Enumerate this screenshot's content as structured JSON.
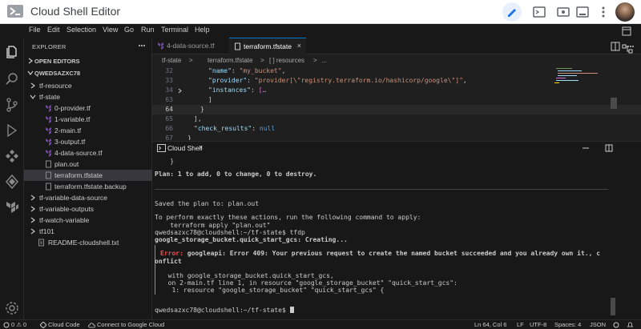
{
  "window": {
    "title": "Cloud Shell Editor"
  },
  "menu": [
    "File",
    "Edit",
    "Selection",
    "View",
    "Go",
    "Run",
    "Terminal",
    "Help"
  ],
  "explorer": {
    "header": "EXPLORER",
    "open_editors": "OPEN EDITORS",
    "workspace": "QWEDSAZXC78",
    "items": [
      {
        "label": "tf-resource",
        "type": "folder",
        "expanded": false
      },
      {
        "label": "tf-state",
        "type": "folder",
        "expanded": true
      },
      {
        "label": "0-provider.tf",
        "type": "tf"
      },
      {
        "label": "1-variable.tf",
        "type": "tf"
      },
      {
        "label": "2-main.tf",
        "type": "tf"
      },
      {
        "label": "3-output.tf",
        "type": "tf"
      },
      {
        "label": "4-data-source.tf",
        "type": "tf"
      },
      {
        "label": "plan.out",
        "type": "file"
      },
      {
        "label": "terraform.tfstate",
        "type": "file",
        "selected": true
      },
      {
        "label": "terraform.tfstate.backup",
        "type": "file"
      },
      {
        "label": "tf-variable-data-source",
        "type": "folder",
        "expanded": false
      },
      {
        "label": "tf-variable-outputs",
        "type": "folder",
        "expanded": false
      },
      {
        "label": "tf-watch-variable",
        "type": "folder",
        "expanded": false
      },
      {
        "label": "tf101",
        "type": "folder",
        "expanded": false
      },
      {
        "label": "README-cloudshell.txt",
        "type": "file"
      }
    ]
  },
  "tabs": [
    {
      "label": "4-data-source.tf",
      "active": false
    },
    {
      "label": "terraform.tfstate",
      "active": true,
      "close": "×"
    }
  ],
  "breadcrumb": [
    "tf-state",
    ">",
    "terraform.tfstate",
    ">",
    "[ ] resources",
    ">",
    "..."
  ],
  "code": {
    "line_numbers": [
      "32",
      "33",
      "34",
      "63",
      "64",
      "65",
      "66",
      "67"
    ],
    "lines": [
      {
        "key": "\"name\"",
        "sep": ": ",
        "val": "\"my_bucket\"",
        "end": ","
      },
      {
        "key": "\"provider\"",
        "sep": ": ",
        "val": "\"provider[\\\"registry.terraform.io/hashicorp/google\\\"]\"",
        "end": ","
      },
      {
        "key": "\"instances\"",
        "sep": ": ",
        "val": "[…",
        "end": ""
      },
      {
        "text": "]"
      },
      {
        "text": "}"
      },
      {
        "text": "],"
      },
      {
        "key": "\"check_results\"",
        "sep": ": ",
        "val": "null",
        "end": ""
      },
      {
        "text": "}"
      }
    ]
  },
  "terminal": {
    "tab_label": "Cloud Shell",
    "close": "×",
    "lines": [
      "    }",
      "Plan: 1 to add, 0 to change, 0 to destroy.",
      "Saved the plan to: plan.out",
      "To perform exactly these actions, run the following command to apply:",
      "    terraform apply \"plan.out\"",
      "qwedsazxc78@cloudshell:~/tf-state$ tfdp",
      "google_storage_bucket.quick_start_gcs: Creating...",
      "Error:",
      " googleapi: Error 409: Your previous request to create the named bucket succeeded and you already own it., c",
      "onflict",
      "  with google_storage_bucket.quick_start_gcs,",
      "  on 2-main.tf line 1, in resource \"google_storage_bucket\" \"quick_start_gcs\":",
      "   1: resource \"google_storage_bucket\" \"quick_start_gcs\" {",
      "qwedsazxc78@cloudshell:~/tf-state$"
    ]
  },
  "status": {
    "problems": "0 ⚠ 0",
    "cloud_code": "Cloud Code",
    "connect": "Connect to Google Cloud",
    "position": "Ln 64, Col 6",
    "eol": "LF",
    "encoding": "UTF-8",
    "spaces": "Spaces: 4",
    "language": "JSON"
  },
  "colors": {
    "accent": "#0078d4",
    "error": "#f14c4c",
    "terraform": "#7b42bc"
  }
}
